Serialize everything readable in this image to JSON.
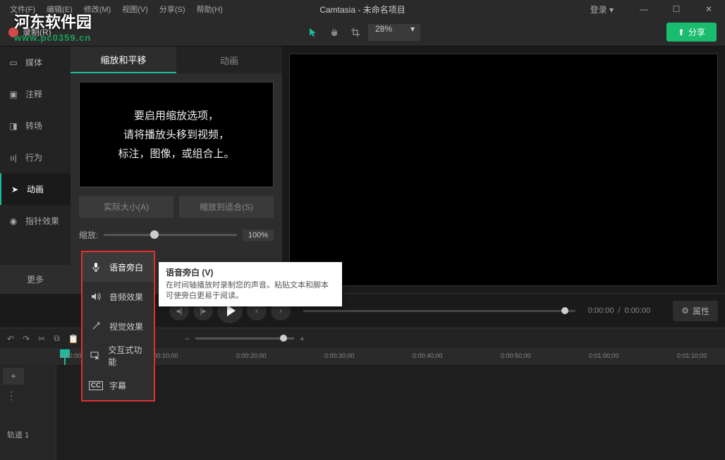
{
  "menubar": {
    "items": [
      "文件(F)",
      "编辑(E)",
      "修改(M)",
      "视图(V)",
      "分享(S)",
      "帮助(H)"
    ],
    "title": "Camtasia - 未命名项目",
    "login": "登录 ▾"
  },
  "toolbar": {
    "record": "录制(R)",
    "zoom": "28%",
    "share": "分享"
  },
  "watermark": {
    "main": "河东软件园",
    "sub": "www.pc0359.cn"
  },
  "sidebar": {
    "items": [
      {
        "label": "媒体"
      },
      {
        "label": "注释"
      },
      {
        "label": "转场"
      },
      {
        "label": "行为"
      },
      {
        "label": "动画"
      },
      {
        "label": "指针效果"
      }
    ],
    "more": "更多"
  },
  "panel": {
    "tabs": [
      "缩放和平移",
      "动画"
    ],
    "hint": "要启用缩放选项，\n请将播放头移到视频，\n标注，图像，或组合上。",
    "btn1": "实际大小(A)",
    "btn2": "缩放到适合(S)",
    "zoom_label": "缩放:",
    "zoom_value": "100%"
  },
  "playback": {
    "time_current": "0:00:00",
    "time_sep": "/",
    "time_total": "0:00:00",
    "props": "属性"
  },
  "timeline": {
    "ticks": [
      "0:00:00",
      "0:00:10;00",
      "0:00:20;00",
      "0:00:30;00",
      "0:00:40;00",
      "0:00:50;00",
      "0:01:00;00",
      "0:01:10;00"
    ],
    "track": "轨道 1"
  },
  "popup": {
    "items": [
      {
        "label": "语音旁白"
      },
      {
        "label": "音频效果"
      },
      {
        "label": "视觉效果"
      },
      {
        "label": "交互式功能"
      },
      {
        "label": "字幕"
      }
    ]
  },
  "tooltip": {
    "title": "语音旁白 (V)",
    "body": "在时间轴播放时录制您的声音。粘贴文本和脚本可使旁白更易于阅读。"
  }
}
